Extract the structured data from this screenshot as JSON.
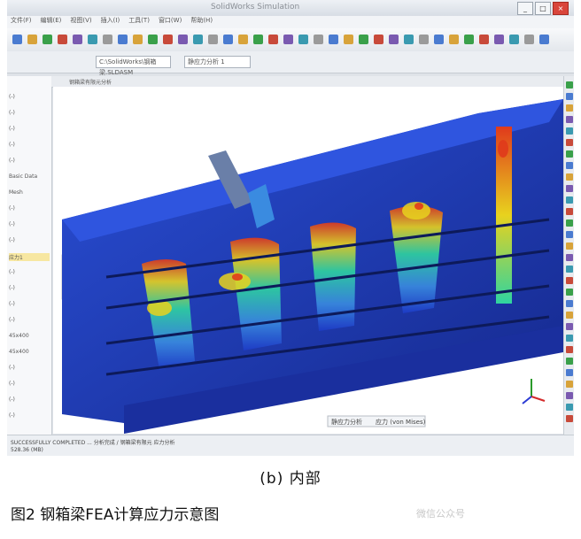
{
  "window": {
    "title": "SolidWorks Simulation"
  },
  "menu": {
    "items": [
      "文件(F)",
      "编辑(E)",
      "视图(V)",
      "插入(I)",
      "工具(T)",
      "窗口(W)",
      "帮助(H)"
    ]
  },
  "toolbar": {
    "file_field": "C:\\SolidWorks\\钢箱梁.SLDASM",
    "study_field": "静应力分析 1"
  },
  "left_panel": {
    "items": [
      "(-)",
      "(-)",
      "(-)",
      "(-)",
      "(-)",
      "Basic Data",
      "Mesh",
      "(-)",
      "(-)",
      "(-)",
      "应力1",
      "(-)",
      "(-)",
      "(-)",
      "(-)",
      "45x400",
      "45x400",
      "(-)",
      "(-)",
      "(-)",
      "(-)"
    ],
    "selected_index": 10
  },
  "viewport": {
    "tab_label": "钢箱梁有限元分析",
    "legend_label": "静应力分析",
    "legend_label2": "应力 (von Mises)"
  },
  "status": {
    "line1": "SUCCESSFULLY COMPLETED ... 分析完成 / 钢箱梁有限元 应力分析",
    "line2": "528.36 (MB)"
  },
  "caption": "(b) 内部",
  "figure_title": "图2   钢箱梁FEA计算应力示意图",
  "watermark": "微信公众号",
  "colors": {
    "stress_low": "#1e3cc8",
    "stress_mid": "#2fd4a0",
    "stress_high": "#e8d21e",
    "stress_max": "#e03a1c"
  }
}
